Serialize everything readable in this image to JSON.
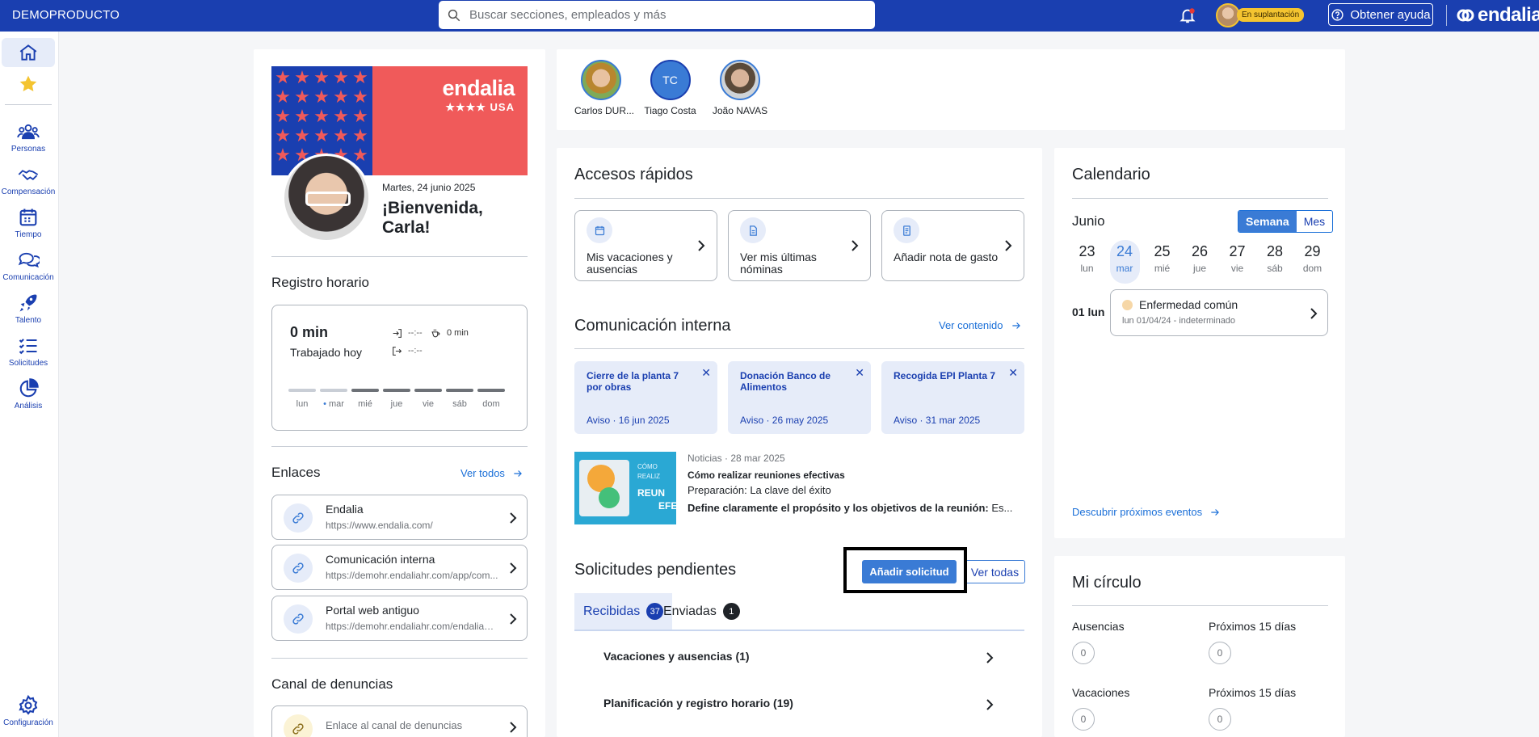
{
  "topbar": {
    "company": "DEMOPRODUCTO",
    "search_placeholder": "Buscar secciones, empleados y más",
    "impersonation_tag": "En suplantación",
    "help_label": "Obtener ayuda",
    "logo": "endalia"
  },
  "sidebar": {
    "items": [
      {
        "label": "Personas"
      },
      {
        "label": "Compensación"
      },
      {
        "label": "Tiempo"
      },
      {
        "label": "Comunicación"
      },
      {
        "label": "Talento"
      },
      {
        "label": "Solicitudes"
      },
      {
        "label": "Análisis"
      }
    ],
    "settings_label": "Configuración"
  },
  "profile": {
    "banner_logo": "endalia",
    "banner_sub": "★★★★ USA",
    "date": "Martes, 24 junio 2025",
    "greeting": "¡Bienvenida, Carla!"
  },
  "registro": {
    "title": "Registro horario",
    "worked": "0 min",
    "worked_label": "Trabajado hoy",
    "in_time": "--:--",
    "out_time": "--:--",
    "break_time": "0 min",
    "days": [
      "lun",
      "mar",
      "mié",
      "jue",
      "vie",
      "sáb",
      "dom"
    ]
  },
  "enlaces": {
    "title": "Enlaces",
    "see_all": "Ver todos",
    "items": [
      {
        "name": "Endalia",
        "url": "https://www.endalia.com/"
      },
      {
        "name": "Comunicación interna",
        "url": "https://demohr.endaliahr.com/app/com..."
      },
      {
        "name": "Portal web antiguo",
        "url": "https://demohr.endaliahr.com/endaliawe..."
      }
    ]
  },
  "denuncias": {
    "title": "Canal de denuncias",
    "link": "Enlace al canal de denuncias"
  },
  "team": [
    {
      "name": "Carlos DUR...",
      "initials": ""
    },
    {
      "name": "Tiago Costa",
      "initials": "TC"
    },
    {
      "name": "João NAVAS",
      "initials": ""
    }
  ],
  "quick_access": {
    "title": "Accesos rápidos",
    "items": [
      {
        "label": "Mis vacaciones y ausencias"
      },
      {
        "label": "Ver mis últimas nóminas"
      },
      {
        "label": "Añadir nota de gasto"
      }
    ]
  },
  "comunicacion": {
    "title": "Comunicación interna",
    "see_content": "Ver contenido",
    "notices": [
      {
        "title": "Cierre de la planta 7 por obras",
        "meta": "Aviso · 16 jun 2025"
      },
      {
        "title": "Donación Banco de Alimentos",
        "meta": "Aviso · 26 may 2025"
      },
      {
        "title": "Recogida EPI Planta 7",
        "meta": "Aviso · 31 mar 2025"
      }
    ],
    "news": {
      "meta": "Noticias · 28 mar 2025",
      "title": "Cómo realizar reuniones efectivas",
      "line1": "Preparación: La clave del éxito",
      "line2_bold": "Define claramente el propósito y los objetivos de la reunión:",
      "line2_rest": " Es...",
      "thumb_text1": "CÓMO",
      "thumb_text2": "REALIZ",
      "thumb_text3": "REUN",
      "thumb_text4": "EFE"
    }
  },
  "solicitudes": {
    "title": "Solicitudes pendientes",
    "add_button": "Añadir solicitud",
    "see_all": "Ver todas",
    "tabs": [
      {
        "label": "Recibidas",
        "count": "37"
      },
      {
        "label": "Enviadas",
        "count": "1"
      }
    ],
    "rows": [
      {
        "label": "Vacaciones y ausencias (1)"
      },
      {
        "label": "Planificación y registro horario (19)"
      }
    ]
  },
  "calendario": {
    "title": "Calendario",
    "month": "Junio",
    "view_week": "Semana",
    "view_month": "Mes",
    "days": [
      {
        "num": "23",
        "wd": "lun"
      },
      {
        "num": "24",
        "wd": "mar"
      },
      {
        "num": "25",
        "wd": "mié"
      },
      {
        "num": "26",
        "wd": "jue"
      },
      {
        "num": "27",
        "wd": "vie"
      },
      {
        "num": "28",
        "wd": "sáb"
      },
      {
        "num": "29",
        "wd": "dom"
      }
    ],
    "event_day": "01 lun",
    "event_title": "Enfermedad común",
    "event_sub": "lun 01/04/24 - indeterminado",
    "discover": "Descubrir próximos eventos"
  },
  "circulo": {
    "title": "Mi círculo",
    "rows": [
      {
        "left_label": "Ausencias",
        "left_count": "0",
        "right_label": "Próximos 15 días",
        "right_count": "0"
      },
      {
        "left_label": "Vacaciones",
        "left_count": "0",
        "right_label": "Próximos 15 días",
        "right_count": "0"
      }
    ]
  },
  "colors": {
    "brand_blue": "#1a3fb0",
    "accent_blue": "#3a7bd5",
    "banner_red": "#f05a5a"
  }
}
